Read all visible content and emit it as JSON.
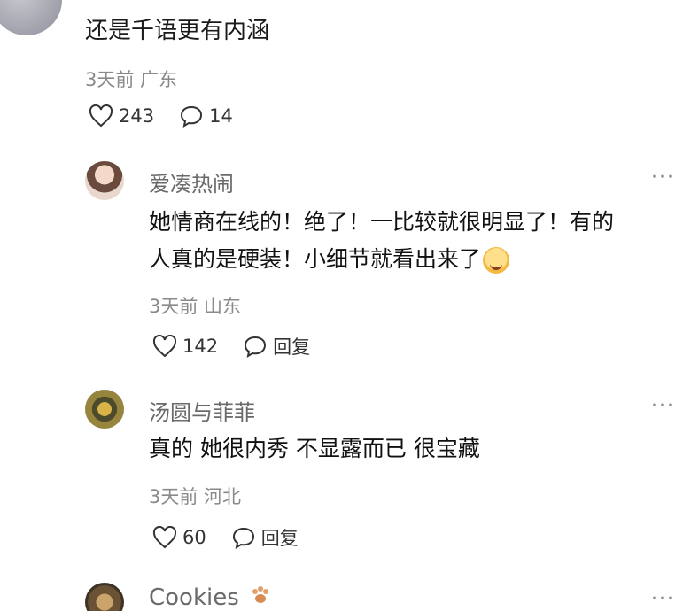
{
  "top_comment": {
    "text": "还是千语更有内涵",
    "meta": "3天前 广东",
    "likes": "243",
    "replies": "14"
  },
  "replies": [
    {
      "username": "爱凑热闹",
      "line1": "她情商在线的！绝了！一比较就很明显了！有的",
      "line2": "人真的是硬装！小细节就看出来了",
      "meta": "3天前 山东",
      "likes": "142",
      "reply_label": "回复",
      "avatar": "avatar-woman"
    },
    {
      "username": "汤圆与菲菲",
      "line1": "真的 她很内秀 不显露而已 很宝藏",
      "meta": "3天前 河北",
      "likes": "60",
      "reply_label": "回复",
      "avatar": "avatar-flowers"
    },
    {
      "username": "Cookies",
      "avatar": "avatar-cookies"
    }
  ],
  "icons": {
    "like": "heart-outline-icon",
    "comment": "speech-bubble-icon",
    "more": "more-dots-icon",
    "emoji": "smiling-face-emoji",
    "paw": "paw-icon"
  },
  "more_glyph": "···"
}
